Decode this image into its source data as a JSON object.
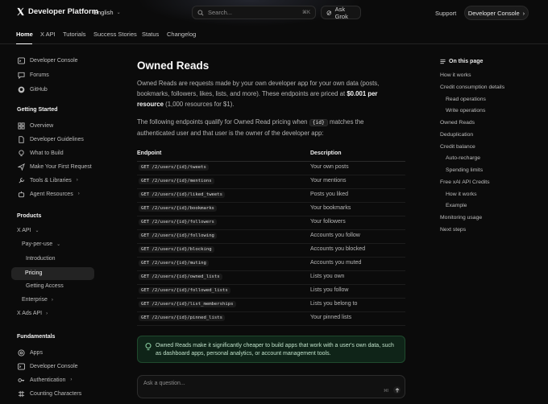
{
  "header": {
    "brand": "Developer Platform",
    "language": "English",
    "search_placeholder": "Search...",
    "search_shortcut": "⌘K",
    "ask_grok": "Ask Grok",
    "support": "Support",
    "developer_console": "Developer Console"
  },
  "tabs": [
    "Home",
    "X API",
    "Tutorials",
    "Success Stories",
    "Status",
    "Changelog"
  ],
  "sidebar": {
    "top_links": [
      {
        "label": "Developer Console",
        "icon": "terminal-icon"
      },
      {
        "label": "Forums",
        "icon": "chat-icon"
      },
      {
        "label": "GitHub",
        "icon": "github-icon"
      }
    ],
    "getting_started": {
      "title": "Getting Started",
      "items": [
        {
          "label": "Overview",
          "icon": "grid-icon"
        },
        {
          "label": "Developer Guidelines",
          "icon": "document-icon"
        },
        {
          "label": "What to Build",
          "icon": "lightbulb-icon"
        },
        {
          "label": "Make Your First Request",
          "icon": "send-icon"
        },
        {
          "label": "Tools & Libraries",
          "icon": "wrench-icon"
        },
        {
          "label": "Agent Resources",
          "icon": "agent-icon"
        }
      ]
    },
    "products": {
      "title": "Products",
      "x_api": "X API",
      "pay_per_use": "Pay-per-use",
      "introduction": "Introduction",
      "pricing": "Pricing",
      "getting_access": "Getting Access",
      "enterprise": "Enterprise",
      "x_ads_api": "X Ads API"
    },
    "fundamentals": {
      "title": "Fundamentals",
      "items": [
        {
          "label": "Apps",
          "icon": "apps-icon"
        },
        {
          "label": "Developer Console",
          "icon": "terminal-icon"
        },
        {
          "label": "Authentication",
          "icon": "key-icon"
        },
        {
          "label": "Counting Characters",
          "icon": "counter-icon"
        }
      ]
    }
  },
  "main": {
    "title": "Owned Reads",
    "para1_a": "Owned Reads are requests made by your own developer app for your own data (posts, bookmarks, followers, likes, lists, and more). These endpoints are priced at ",
    "para1_price": "$0.001 per resource",
    "para1_b": " (1,000 resources for $1).",
    "para2_a": "The following endpoints qualify for Owned Read pricing when ",
    "para2_code": "{id}",
    "para2_b": " matches the authenticated user and that user is the owner of the developer app:",
    "table": {
      "col_endpoint": "Endpoint",
      "col_description": "Description",
      "rows": [
        {
          "endpoint": "GET /2/users/{id}/tweets",
          "description": "Your own posts"
        },
        {
          "endpoint": "GET /2/users/{id}/mentions",
          "description": "Your mentions"
        },
        {
          "endpoint": "GET /2/users/{id}/liked_tweets",
          "description": "Posts you liked"
        },
        {
          "endpoint": "GET /2/users/{id}/bookmarks",
          "description": "Your bookmarks"
        },
        {
          "endpoint": "GET /2/users/{id}/followers",
          "description": "Your followers"
        },
        {
          "endpoint": "GET /2/users/{id}/following",
          "description": "Accounts you follow"
        },
        {
          "endpoint": "GET /2/users/{id}/blocking",
          "description": "Accounts you blocked"
        },
        {
          "endpoint": "GET /2/users/{id}/muting",
          "description": "Accounts you muted"
        },
        {
          "endpoint": "GET /2/users/{id}/owned_lists",
          "description": "Lists you own"
        },
        {
          "endpoint": "GET /2/users/{id}/followed_lists",
          "description": "Lists you follow"
        },
        {
          "endpoint": "GET /2/users/{id}/list_memberships",
          "description": "Lists you belong to"
        },
        {
          "endpoint": "GET /2/users/{id}/pinned_lists",
          "description": "Your pinned lists"
        }
      ]
    },
    "callout": "Owned Reads make it significantly cheaper to build apps that work with a user's own data, such as dashboard apps, personal analytics, or account management tools.",
    "ask_placeholder": "Ask a question...",
    "ask_shortcut": "⌘I"
  },
  "toc": {
    "title": "On this page",
    "items": [
      {
        "label": "How it works",
        "indent": false
      },
      {
        "label": "Credit consumption details",
        "indent": false
      },
      {
        "label": "Read operations",
        "indent": true
      },
      {
        "label": "Write operations",
        "indent": true
      },
      {
        "label": "Owned Reads",
        "indent": false
      },
      {
        "label": "Deduplication",
        "indent": false
      },
      {
        "label": "Credit balance",
        "indent": false
      },
      {
        "label": "Auto-recharge",
        "indent": true
      },
      {
        "label": "Spending limits",
        "indent": true
      },
      {
        "label": "Free xAI API Credits",
        "indent": false
      },
      {
        "label": "How it works",
        "indent": true
      },
      {
        "label": "Example",
        "indent": true
      },
      {
        "label": "Monitoring usage",
        "indent": false
      },
      {
        "label": "Next steps",
        "indent": false
      }
    ]
  },
  "colors": {
    "background": "#0b0b0b",
    "callout_bg": "#0f2418",
    "callout_border": "#1f4a2d",
    "accent_text": "#ffffff"
  }
}
